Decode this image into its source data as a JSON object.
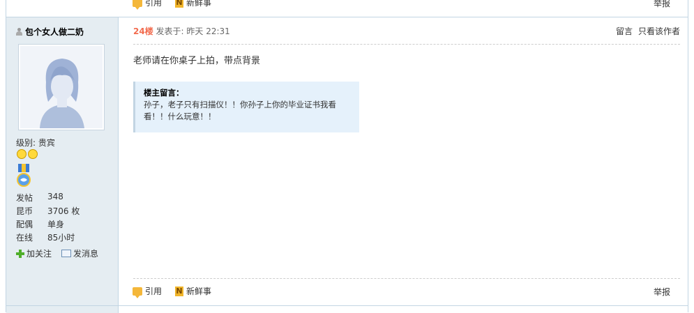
{
  "prev_post": {
    "quote_label": "引用",
    "fresh_label": "新鲜事",
    "report_label": "举报"
  },
  "user": {
    "name": "包个女人做二奶",
    "level_label": "级别:",
    "level_value": "贵宾",
    "stats": [
      {
        "label": "发帖",
        "value": "348"
      },
      {
        "label": "昆币",
        "value": "3706 枚"
      },
      {
        "label": "配偶",
        "value": "单身"
      },
      {
        "label": "在线",
        "value": "85小时"
      }
    ],
    "follow_label": "加关注",
    "message_label": "发消息"
  },
  "post": {
    "floor": "24楼",
    "posted_prefix": "发表于:",
    "posted_time": "昨天 22:31",
    "comment_label": "留言",
    "only_author_label": "只看该作者",
    "body": "老师请在你桌子上拍，带点背景",
    "note_title": "楼主留言：",
    "note_text": "孙子，老子只有扫描仪！！你孙子上你的毕业证书我看看！！什么玩意！！",
    "quote_label": "引用",
    "fresh_label": "新鲜事",
    "report_label": "举报"
  }
}
